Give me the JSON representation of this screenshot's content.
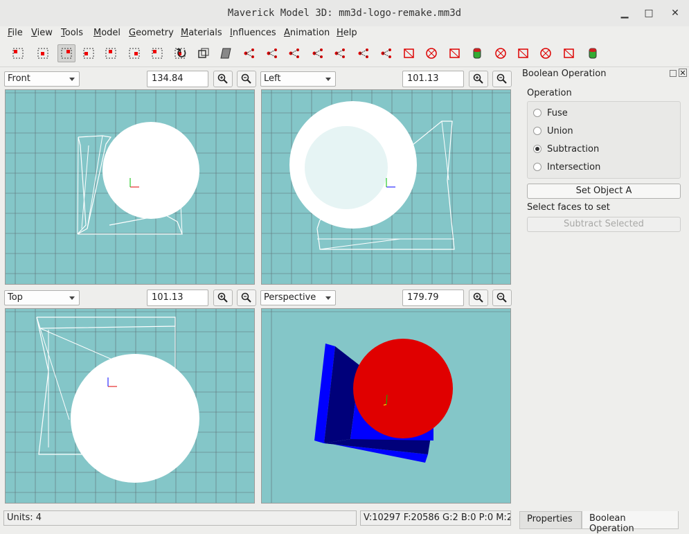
{
  "window": {
    "title": "Maverick Model 3D: mm3d-logo-remake.mm3d",
    "minimize_glyph": "▁",
    "maximize_glyph": "□",
    "close_glyph": "✕"
  },
  "menus": [
    {
      "label": "File",
      "key": "F",
      "rest": "ile"
    },
    {
      "label": "View",
      "key": "V",
      "rest": "iew"
    },
    {
      "label": "Tools",
      "key": "T",
      "rest": "ools"
    },
    {
      "label": "Model",
      "key": "M",
      "rest": "odel"
    },
    {
      "label": "Geometry",
      "key": "G",
      "rest": "eometry"
    },
    {
      "label": "Materials",
      "key": "M",
      "rest": "aterials"
    },
    {
      "label": "Influences",
      "key": "I",
      "rest": "nfluences"
    },
    {
      "label": "Animation",
      "key": "A",
      "rest": "nimation"
    },
    {
      "label": "Help",
      "key": "H",
      "rest": "elp"
    }
  ],
  "toolbar": {
    "icons": [
      "select-vertices-icon",
      "select-faces-icon",
      "select-connected-icon",
      "select-groups-icon",
      "select-bone-joints-icon",
      "select-points-icon",
      "select-projections-icon",
      "select-object-icon",
      "move-icon",
      "rotate-icon",
      "scale-icon",
      "shear-icon",
      "extrude-icon",
      "attach-vertex-icon",
      "create-vertex-icon",
      "create-face-icon",
      "create-bone-joint-icon",
      "create-point-icon",
      "create-projection-icon",
      "create-cube-icon",
      "create-ellipsoid-icon",
      "create-rect-icon",
      "create-cylinder-icon",
      "create-torus-icon",
      "create-polygon-icon",
      "create-torus-knot-icon",
      "create-plane-icon",
      "create-cylinder-shape-icon"
    ],
    "active_index": 2
  },
  "viewports": [
    {
      "view": "Front",
      "zoom": "134.84"
    },
    {
      "view": "Left",
      "zoom": "101.13"
    },
    {
      "view": "Top",
      "zoom": "101.13"
    },
    {
      "view": "Perspective",
      "zoom": "179.79"
    }
  ],
  "colors": {
    "viewport_bg": "#84c6c8",
    "grid": "#5f6f75",
    "wire": "#ffffff",
    "sphere_red": "#e00000",
    "box_blue": "#0000ff",
    "box_dark": "#00007a"
  },
  "panel": {
    "title": "Boolean Operation",
    "operation_label": "Operation",
    "options": [
      {
        "label": "Fuse",
        "checked": false
      },
      {
        "label": "Union",
        "checked": false
      },
      {
        "label": "Subtraction",
        "checked": true
      },
      {
        "label": "Intersection",
        "checked": false
      }
    ],
    "set_object_button": "Set Object A",
    "select_hint": "Select faces to set",
    "subtract_button": "Subtract Selected"
  },
  "status": {
    "units": "Units: 4",
    "stats": "V:10297 F:20586 G:2 B:0 P:0 M:2"
  },
  "tabs": {
    "properties": "Properties",
    "boolean": "Boolean Operation"
  }
}
